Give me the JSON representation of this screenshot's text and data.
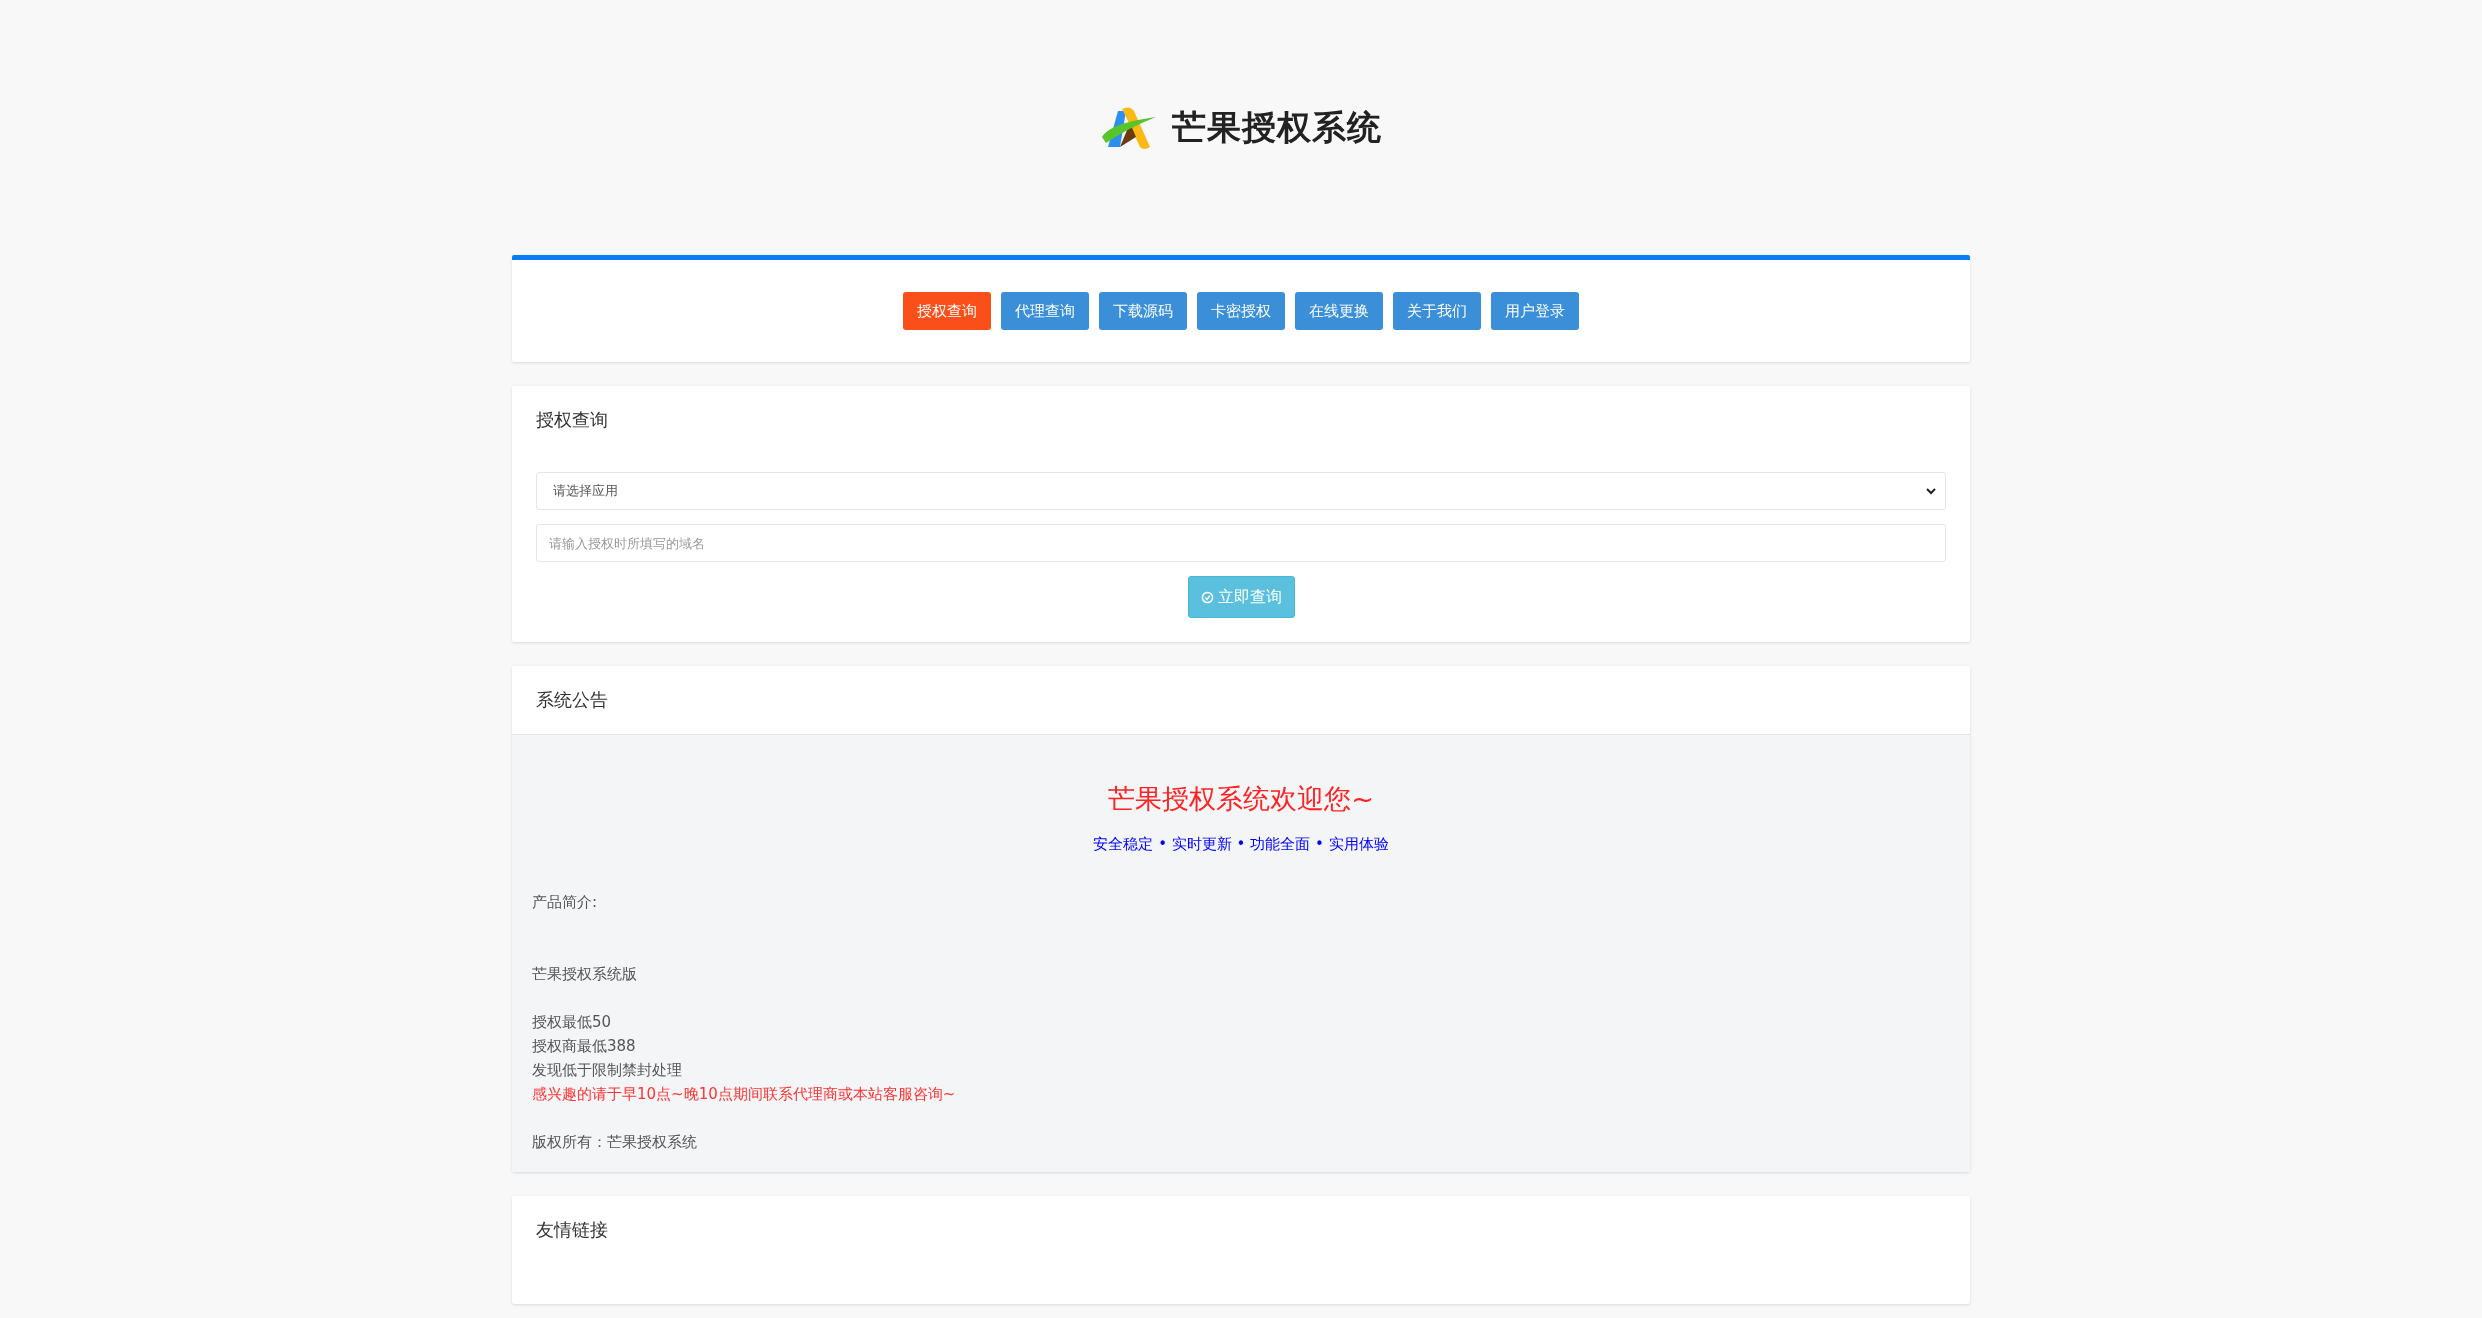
{
  "header": {
    "logo_text": "芒果授权系统"
  },
  "nav": [
    {
      "label": "授权查询",
      "selected": true
    },
    {
      "label": "代理查询",
      "selected": false
    },
    {
      "label": "下载源码",
      "selected": false
    },
    {
      "label": "卡密授权",
      "selected": false
    },
    {
      "label": "在线更换",
      "selected": false
    },
    {
      "label": "关于我们",
      "selected": false
    },
    {
      "label": "用户登录",
      "selected": false
    }
  ],
  "query": {
    "title": "授权查询",
    "select": {
      "value": "请选择应用"
    },
    "domain": {
      "placeholder": "请输入授权时所填写的域名"
    },
    "button": "立即查询"
  },
  "announcement": {
    "title": "系统公告",
    "welcome": "芒果授权系统欢迎您~",
    "tagline": "安全稳定 • 实时更新 • 功能全面 • 实用体验",
    "lines": [
      {
        "kind": "text",
        "text": "产品简介:"
      },
      {
        "kind": "blank"
      },
      {
        "kind": "blank"
      },
      {
        "kind": "text",
        "text": "芒果授权系统版"
      },
      {
        "kind": "blank"
      },
      {
        "kind": "text",
        "text": "授权最低50"
      },
      {
        "kind": "text",
        "text": "授权商最低388"
      },
      {
        "kind": "text",
        "text": "发现低于限制禁封处理"
      },
      {
        "kind": "highlight",
        "text": "感兴趣的请于早10点~晚10点期间联系代理商或本站客服咨询~"
      },
      {
        "kind": "blank"
      },
      {
        "kind": "text",
        "text": "版权所有：芒果授权系统"
      }
    ]
  },
  "links": {
    "title": "友情链接"
  }
}
